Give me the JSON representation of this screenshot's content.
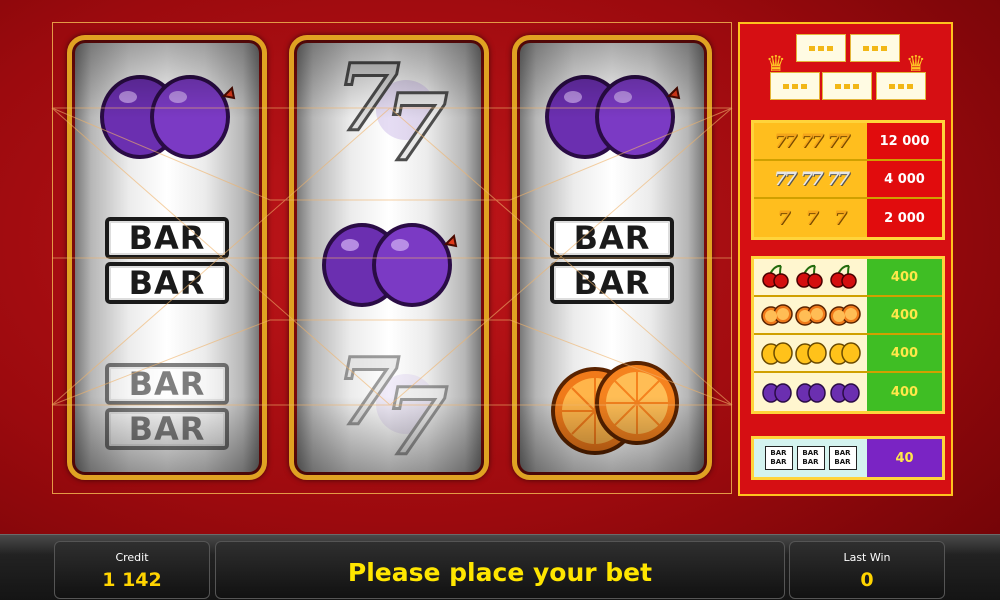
{
  "reels": [
    {
      "symbols": [
        "plum",
        "bar-double",
        "bar-double"
      ]
    },
    {
      "symbols": [
        "seven-silver",
        "plum",
        "seven-silver"
      ]
    },
    {
      "symbols": [
        "plum",
        "bar-double",
        "orange"
      ]
    }
  ],
  "bar_symbol_text": "BAR",
  "paytable": {
    "sevens": [
      {
        "symbol": "seven-gold",
        "payout": "12 000"
      },
      {
        "symbol": "seven-silver",
        "payout": "4 000"
      },
      {
        "symbol": "seven-small-gold",
        "payout": "2 000"
      }
    ],
    "fruits": [
      {
        "symbol": "cherry",
        "payout": "400"
      },
      {
        "symbol": "orange",
        "payout": "400"
      },
      {
        "symbol": "lemon",
        "payout": "400"
      },
      {
        "symbol": "plum",
        "payout": "400"
      }
    ],
    "bar": {
      "symbol": "bar",
      "label": "BAR",
      "payout": "40"
    }
  },
  "credit": {
    "label": "Credit",
    "value": "1 142"
  },
  "status_message": "Please place your bet",
  "last_win": {
    "label": "Last Win",
    "value": "0"
  },
  "colors": {
    "background": "#b3101a",
    "reel_border": "#e0a222",
    "sevens_payout_bg": "#e10c0d",
    "fruits_payout_bg": "#3fbe24",
    "bar_payout_bg": "#7a24c4",
    "panel_value": "#ffd400",
    "message_text": "#ffe600"
  }
}
